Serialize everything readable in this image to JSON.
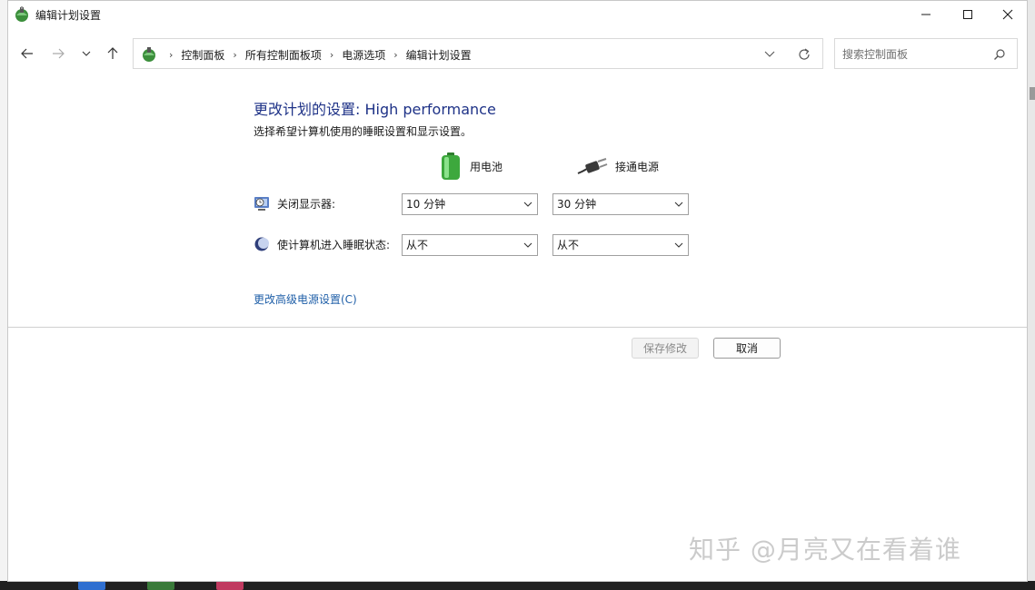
{
  "window": {
    "title": "编辑计划设置",
    "controls": {
      "minimize": "minimize",
      "maximize": "maximize",
      "close": "close"
    }
  },
  "nav": {
    "breadcrumbs": [
      "控制面板",
      "所有控制面板项",
      "电源选项",
      "编辑计划设置"
    ],
    "search_placeholder": "搜索控制面板"
  },
  "content": {
    "title": "更改计划的设置: High performance",
    "subtitle": "选择希望计算机使用的睡眠设置和显示设置。",
    "columns": {
      "battery": "用电池",
      "plugged_in": "接通电源"
    },
    "rows": [
      {
        "label": "关闭显示器:",
        "battery": "10 分钟",
        "plugged_in": "30 分钟"
      },
      {
        "label": "使计算机进入睡眠状态:",
        "battery": "从不",
        "plugged_in": "从不"
      }
    ],
    "advanced_link": "更改高级电源设置(C)"
  },
  "footer": {
    "save_label": "保存修改",
    "cancel_label": "取消"
  },
  "watermark": "知乎 @月亮又在看着谁",
  "colors": {
    "title": "#1e3287",
    "link": "#1f5fa8",
    "disabled_text": "#8a8a8a"
  }
}
